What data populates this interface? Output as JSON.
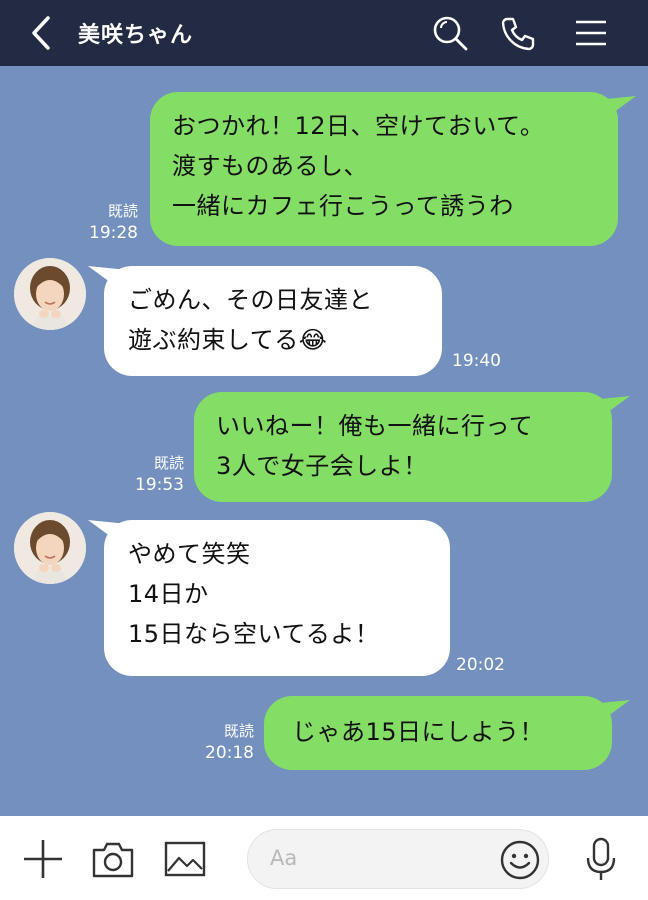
{
  "header": {
    "title": "美咲ちゃん",
    "icons": [
      "back-icon",
      "search-icon",
      "phone-icon",
      "menu-icon"
    ]
  },
  "messages": [
    {
      "direction": "outgoing",
      "lines": [
        "おつかれ！12日、空けておいて。",
        "渡すものあるし、",
        "一緒にカフェ行こうって誘うわ"
      ],
      "read_label": "既読",
      "time": "19:28"
    },
    {
      "direction": "incoming",
      "lines": [
        "ごめん、その日友達と",
        "遊ぶ約束してる😂"
      ],
      "time": "19:40"
    },
    {
      "direction": "outgoing",
      "lines": [
        "いいねー！俺も一緒に行って",
        "3人で女子会しよ！"
      ],
      "read_label": "既読",
      "time": "19:53"
    },
    {
      "direction": "incoming",
      "lines": [
        "やめて笑笑",
        "14日か",
        "15日なら空いてるよ！"
      ],
      "time": "20:02"
    },
    {
      "direction": "outgoing",
      "lines": [
        "じゃあ15日にしよう！"
      ],
      "read_label": "既読",
      "time": "20:18"
    }
  ],
  "input": {
    "placeholder": "Aa",
    "icons": [
      "plus-icon",
      "camera-icon",
      "image-icon",
      "emoji-icon",
      "microphone-icon"
    ]
  },
  "colors": {
    "header_bg": "#232a43",
    "chat_bg": "#7390bf",
    "outgoing_bubble": "#84dd64",
    "incoming_bubble": "#ffffff"
  }
}
